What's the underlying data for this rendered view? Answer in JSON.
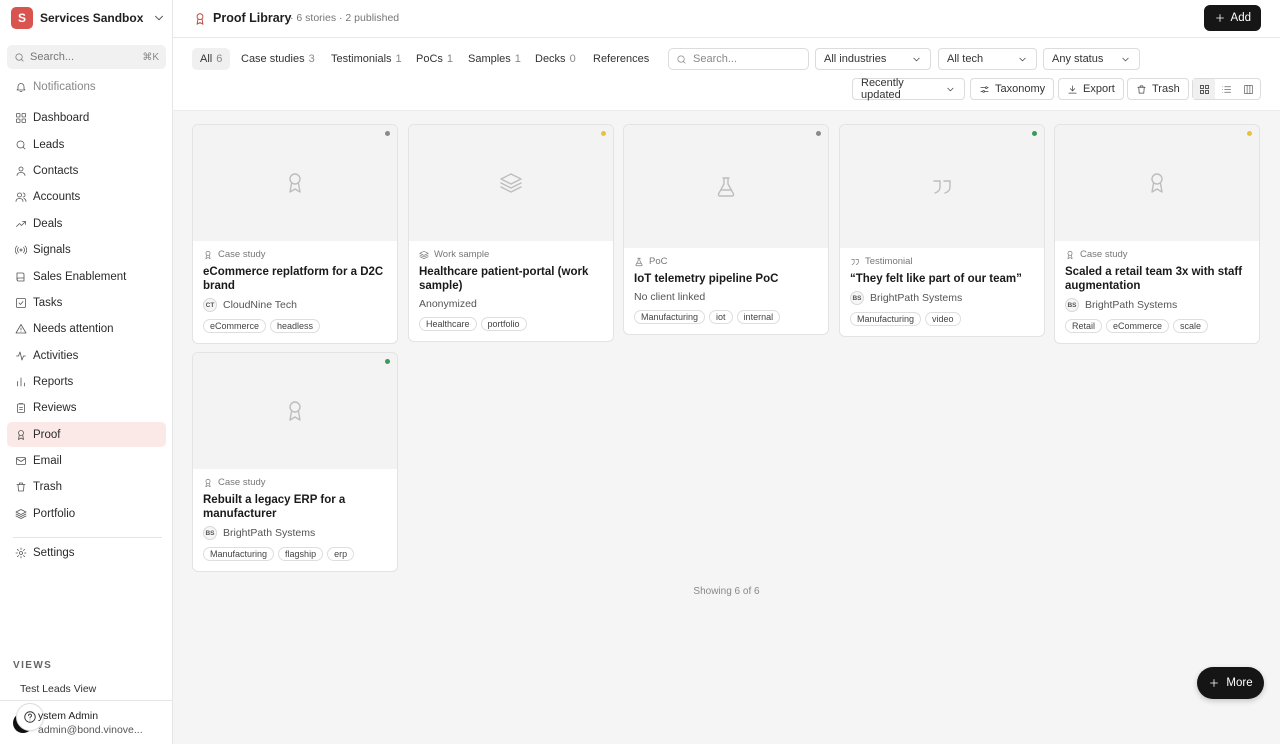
{
  "workspace": {
    "initial": "S",
    "name": "Services Sandbox"
  },
  "sidebar": {
    "search_placeholder": "Search...",
    "search_shortcut": "⌘K",
    "notifications": "Notifications",
    "items": [
      {
        "label": "Dashboard",
        "icon": "grid-icon"
      },
      {
        "label": "Leads",
        "icon": "search-icon"
      },
      {
        "label": "Contacts",
        "icon": "user-icon"
      },
      {
        "label": "Accounts",
        "icon": "users-icon"
      },
      {
        "label": "Deals",
        "icon": "trend-icon"
      },
      {
        "label": "Signals",
        "icon": "signal-icon"
      },
      {
        "label": "Sales Enablement",
        "icon": "book-icon"
      },
      {
        "label": "Tasks",
        "icon": "task-icon"
      },
      {
        "label": "Needs attention",
        "icon": "alert-icon"
      },
      {
        "label": "Activities",
        "icon": "activity-icon"
      },
      {
        "label": "Reports",
        "icon": "bar-chart-icon"
      },
      {
        "label": "Reviews",
        "icon": "clipboard-icon"
      },
      {
        "label": "Proof",
        "icon": "award-icon"
      },
      {
        "label": "Email",
        "icon": "mail-icon"
      },
      {
        "label": "Trash",
        "icon": "trash-icon"
      },
      {
        "label": "Portfolio",
        "icon": "layers-icon"
      }
    ],
    "settings": "Settings",
    "views_heading": "VIEWS",
    "views": [
      "Test Leads View"
    ]
  },
  "user": {
    "name": "ystem Admin",
    "email": "admin@bond.vinove..."
  },
  "header": {
    "title": "Proof Library",
    "meta": "· 6 stories · 2 published",
    "add_label": "Add"
  },
  "tabs": [
    {
      "label": "All",
      "count": "6"
    },
    {
      "label": "Case studies",
      "count": "3"
    },
    {
      "label": "Testimonials",
      "count": "1"
    },
    {
      "label": "PoCs",
      "count": "1"
    },
    {
      "label": "Samples",
      "count": "1"
    },
    {
      "label": "Decks",
      "count": "0"
    },
    {
      "label": "References",
      "count": ""
    }
  ],
  "filters": {
    "search_placeholder": "Search...",
    "industry": "All industries",
    "tech": "All tech",
    "status": "Any status",
    "sort": "Recently updated",
    "taxonomy": "Taxonomy",
    "export": "Export",
    "trash": "Trash"
  },
  "colors": {
    "published": "#3a9a5b",
    "draft": "#e8c33a",
    "archived": "#8a8a8a",
    "accent": "#b5443a"
  },
  "cards": [
    {
      "type": "Case study",
      "icon": "award-icon",
      "title": "eCommerce replatform for a D2C brand",
      "client_initials": "CT",
      "client": "CloudNine Tech",
      "tags": [
        "eCommerce",
        "headless"
      ],
      "status_color": "#8a8a8a"
    },
    {
      "type": "Work sample",
      "icon": "layers-icon",
      "title": "Healthcare patient-portal (work sample)",
      "client_initials": "",
      "client": "Anonymized",
      "tags": [
        "Healthcare",
        "portfolio"
      ],
      "status_color": "#e8c33a"
    },
    {
      "type": "PoC",
      "icon": "flask-icon",
      "title": "IoT telemetry pipeline PoC",
      "client_initials": "",
      "client": "No client linked",
      "tags": [
        "Manufacturing",
        "iot",
        "internal"
      ],
      "status_color": "#8a8a8a"
    },
    {
      "type": "Testimonial",
      "icon": "quote-icon",
      "title": "“They felt like part of our team”",
      "client_initials": "BS",
      "client": "BrightPath Systems",
      "tags": [
        "Manufacturing",
        "video"
      ],
      "status_color": "#3a9a5b"
    },
    {
      "type": "Case study",
      "icon": "award-icon",
      "title": "Scaled a retail team 3x with staff augmentation",
      "client_initials": "BS",
      "client": "BrightPath Systems",
      "tags": [
        "Retail",
        "eCommerce",
        "scale"
      ],
      "status_color": "#e8c33a"
    },
    {
      "type": "Case study",
      "icon": "award-icon",
      "title": "Rebuilt a legacy ERP for a manufacturer",
      "client_initials": "BS",
      "client": "BrightPath Systems",
      "tags": [
        "Manufacturing",
        "flagship",
        "erp"
      ],
      "status_color": "#3a9a5b"
    }
  ],
  "showing": "Showing 6 of 6",
  "more_label": "More"
}
